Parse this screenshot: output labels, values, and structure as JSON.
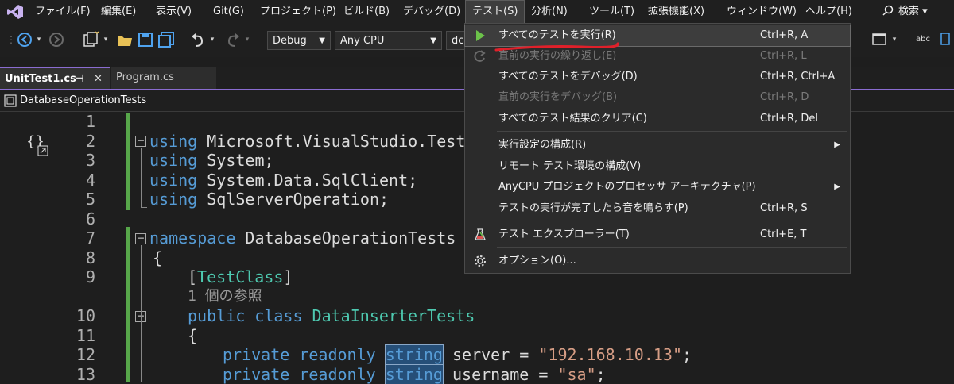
{
  "menubar": {
    "items": [
      "ファイル(F)",
      "編集(E)",
      "表示(V)",
      "Git(G)",
      "プロジェクト(P)",
      "ビルド(B)",
      "デバッグ(D)",
      "テスト(S)",
      "分析(N)",
      "ツール(T)",
      "拡張機能(X)",
      "ウィンドウ(W)",
      "ヘルプ(H)"
    ],
    "search_label": "検索 ▾"
  },
  "toolbar": {
    "config": "Debug",
    "platform": "Any CPU",
    "target_partial": "dc"
  },
  "tabs": {
    "active": "UnitTest1.cs",
    "inactive": "Program.cs",
    "pin": "⊣",
    "close": "✕"
  },
  "navbar": {
    "namespace": "DatabaseOperationTests"
  },
  "editor": {
    "line_numbers": [
      "1",
      "2",
      "3",
      "4",
      "5",
      "6",
      "7",
      "8",
      "9",
      "",
      "10",
      "11",
      "12",
      "13"
    ],
    "lines": {
      "l2_kw": "using",
      "l2_rest": " Microsoft.VisualStudio.TestTo",
      "l3_kw": "using",
      "l3_rest": " System;",
      "l4_kw": "using",
      "l4_rest": " System.Data.SqlClient;",
      "l5_kw": "using",
      "l5_rest": " SqlServerOperation;",
      "l7_kw": "namespace",
      "l7_rest": " DatabaseOperationTests",
      "l8": "{",
      "l9_open": "[",
      "l9_attr": "TestClass",
      "l9_close": "]",
      "ref_count": "1 個の参照",
      "l10_kw": "public class",
      "l10_type": " DataInserterTests",
      "l11": "{",
      "l12_kw": "private readonly",
      "l12_type": "string",
      "l12_rest": " server = ",
      "l12_str": "\"192.168.10.13\"",
      "l12_end": ";",
      "l13_kw": "private readonly",
      "l13_type": "string",
      "l13_rest": " username = ",
      "l13_str": "\"sa\"",
      "l13_end": ";"
    }
  },
  "test_menu": {
    "items": [
      {
        "label": "すべてのテストを実行(R)",
        "shortcut": "Ctrl+R, A",
        "icon": "play-icon"
      },
      {
        "label": "直前の実行の繰り返し(E)",
        "shortcut": "Ctrl+R, L",
        "icon": "repeat-icon"
      },
      {
        "label": "すべてのテストをデバッグ(D)",
        "shortcut": "Ctrl+R, Ctrl+A"
      },
      {
        "label": "直前の実行をデバッグ(B)",
        "shortcut": "Ctrl+R, D"
      },
      {
        "label": "すべてのテスト結果のクリア(C)",
        "shortcut": "Ctrl+R, Del"
      },
      {
        "label": "実行設定の構成(R)",
        "shortcut": ""
      },
      {
        "label": "リモート テスト環境の構成(V)",
        "shortcut": ""
      },
      {
        "label": "AnyCPU プロジェクトのプロセッサ アーキテクチャ(P)",
        "shortcut": ""
      },
      {
        "label": "テストの実行が完了したら音を鳴らす(P)",
        "shortcut": "Ctrl+R, S"
      },
      {
        "label": "テスト エクスプローラー(T)",
        "shortcut": "Ctrl+E, T",
        "icon": "test-explorer-icon"
      },
      {
        "label": "オプション(O)...",
        "shortcut": "",
        "icon": "gear-icon"
      }
    ]
  },
  "colors": {
    "accent_purple": "#8a6cd1",
    "keyword": "#569cd6",
    "type": "#4ec9b0",
    "string": "#d69d85",
    "annotation_red": "#e0202a"
  }
}
